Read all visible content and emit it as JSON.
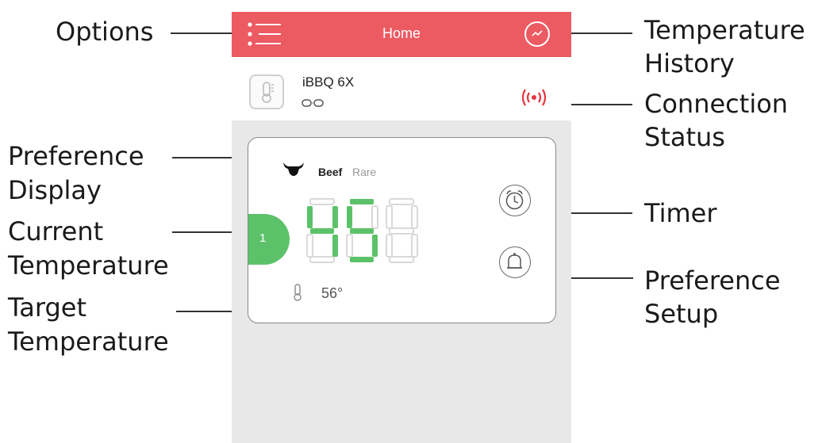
{
  "annotations": {
    "options": "Options",
    "temp_history_line1": "Temperature",
    "temp_history_line2": "History",
    "connection_line1": "Connection",
    "connection_line2": "Status",
    "pref_display_line1": "Preference",
    "pref_display_line2": "Display",
    "current_temp_line1": "Current",
    "current_temp_line2": "Temperature",
    "target_temp_line1": "Target",
    "target_temp_line2": "Temperature",
    "timer": "Timer",
    "pref_setup_line1": "Preference",
    "pref_setup_line2": "Setup"
  },
  "app": {
    "header_title": "Home",
    "device_name": "iBBQ 6X",
    "probe": {
      "number": "1",
      "meat": "Beef",
      "doneness": "Rare",
      "current_temp": "45",
      "target_temp": "56°"
    }
  },
  "colors": {
    "header": "#ec5a62",
    "probe_green": "#5cc26a",
    "signal_red": "#e8353f"
  },
  "icons": {
    "menu": "menu-icon",
    "history": "chart-history-icon",
    "device": "thermometer-icon",
    "link": "link-icon",
    "signal": "signal-icon",
    "bull": "bull-icon",
    "timer": "alarm-clock-icon",
    "bell": "bell-icon",
    "target": "thermometer-icon"
  }
}
